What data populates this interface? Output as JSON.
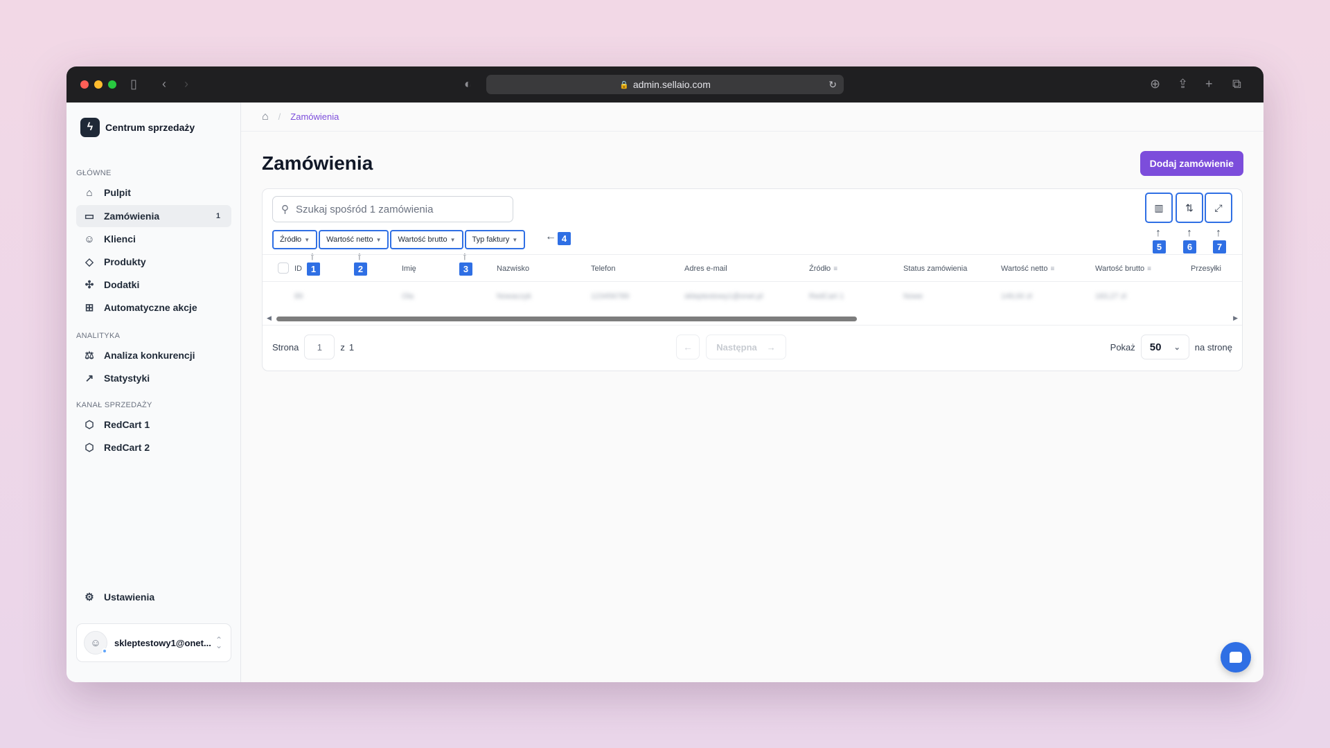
{
  "browser": {
    "url": "admin.sellaio.com"
  },
  "brand": {
    "name": "Centrum sprzedaży"
  },
  "sidebar": {
    "sections": {
      "main": "GŁÓWNE",
      "analytics": "ANALITYKA",
      "channels": "KANAŁ SPRZEDAŻY"
    },
    "items": [
      {
        "label": "Pulpit",
        "icon": "home-icon"
      },
      {
        "label": "Zamówienia",
        "icon": "inbox-icon",
        "badge": "1"
      },
      {
        "label": "Klienci",
        "icon": "user-icon"
      },
      {
        "label": "Produkty",
        "icon": "tag-icon"
      },
      {
        "label": "Dodatki",
        "icon": "puzzle-icon"
      },
      {
        "label": "Automatyczne akcje",
        "icon": "workflow-icon"
      },
      {
        "label": "Analiza konkurencji",
        "icon": "scale-icon"
      },
      {
        "label": "Statystyki",
        "icon": "trend-icon"
      },
      {
        "label": "RedCart 1",
        "icon": "redcart-icon"
      },
      {
        "label": "RedCart 2",
        "icon": "redcart-icon"
      }
    ],
    "settings": "Ustawienia",
    "user_email": "skleptestowy1@onet..."
  },
  "breadcrumb": {
    "current": "Zamówienia"
  },
  "page": {
    "title": "Zamówienia",
    "add_button": "Dodaj zamówienie"
  },
  "search": {
    "placeholder": "Szukaj spośród 1 zamówienia"
  },
  "filters": [
    "Źródło",
    "Wartość netto",
    "Wartość brutto",
    "Typ faktury"
  ],
  "markers": [
    "1",
    "2",
    "3",
    "4",
    "5",
    "6",
    "7"
  ],
  "table": {
    "columns": [
      "ID",
      "Imię",
      "Nazwisko",
      "Telefon",
      "Adres e-mail",
      "Źródło",
      "Status zamówienia",
      "Wartość netto",
      "Wartość brutto",
      "Przesyłki"
    ],
    "row": [
      "89",
      "Ola",
      "Nowaczyk",
      "123456789",
      "skleptestowy1@onet.pl",
      "RedCart 1",
      "Nowe",
      "149,00 zł",
      "183,27 zł"
    ]
  },
  "pagination": {
    "page_label": "Strona",
    "page_value": "1",
    "of_label": "z",
    "total": "1",
    "next": "Następna",
    "show_label": "Pokaż",
    "per_page": "50",
    "per_page_suffix": "na stronę"
  },
  "colors": {
    "accent": "#7c4ddb",
    "marker": "#2f6fe4"
  }
}
